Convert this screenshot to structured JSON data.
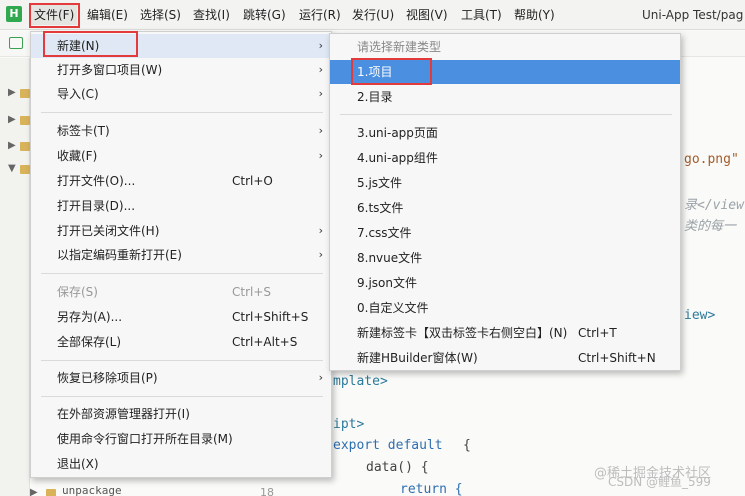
{
  "app": {
    "logo": "H",
    "title": "Uni-App Test/pag"
  },
  "menubar": {
    "items": [
      {
        "label": "文件(F)"
      },
      {
        "label": "编辑(E)"
      },
      {
        "label": "选择(S)"
      },
      {
        "label": "查找(I)"
      },
      {
        "label": "跳转(G)"
      },
      {
        "label": "运行(R)"
      },
      {
        "label": "发行(U)"
      },
      {
        "label": "视图(V)"
      },
      {
        "label": "工具(T)"
      },
      {
        "label": "帮助(Y)"
      }
    ]
  },
  "file_menu": {
    "items": [
      {
        "label": "新建(N)",
        "shortcut": "",
        "submenu": true
      },
      {
        "label": "打开多窗口项目(W)",
        "shortcut": "",
        "submenu": true
      },
      {
        "label": "导入(C)",
        "shortcut": "",
        "submenu": true
      },
      {
        "label": "标签卡(T)",
        "shortcut": "",
        "submenu": true
      },
      {
        "label": "收藏(F)",
        "shortcut": "",
        "submenu": true
      },
      {
        "label": "打开文件(O)...",
        "shortcut": "Ctrl+O"
      },
      {
        "label": "打开目录(D)...",
        "shortcut": ""
      },
      {
        "label": "打开已关闭文件(H)",
        "shortcut": "",
        "submenu": true
      },
      {
        "label": "以指定编码重新打开(E)",
        "shortcut": "",
        "submenu": true
      },
      {
        "label": "保存(S)",
        "shortcut": "Ctrl+S",
        "disabled": true
      },
      {
        "label": "另存为(A)...",
        "shortcut": "Ctrl+Shift+S"
      },
      {
        "label": "全部保存(L)",
        "shortcut": "Ctrl+Alt+S"
      },
      {
        "label": "恢复已移除项目(P)",
        "shortcut": "",
        "submenu": true
      },
      {
        "label": "在外部资源管理器打开(I)",
        "shortcut": ""
      },
      {
        "label": "使用命令行窗口打开所在目录(M)",
        "shortcut": ""
      },
      {
        "label": "退出(X)",
        "shortcut": ""
      }
    ]
  },
  "new_submenu": {
    "header": "请选择新建类型",
    "items": [
      {
        "label": "1.项目",
        "shortcut": ""
      },
      {
        "label": "2.目录",
        "shortcut": ""
      },
      {
        "label": "3.uni-app页面",
        "shortcut": ""
      },
      {
        "label": "4.uni-app组件",
        "shortcut": ""
      },
      {
        "label": "5.js文件",
        "shortcut": ""
      },
      {
        "label": "6.ts文件",
        "shortcut": ""
      },
      {
        "label": "7.css文件",
        "shortcut": ""
      },
      {
        "label": "8.nvue文件",
        "shortcut": ""
      },
      {
        "label": "9.json文件",
        "shortcut": ""
      },
      {
        "label": "0.自定义文件",
        "shortcut": ""
      },
      {
        "label": "新建标签卡【双击标签卡右侧空白】(N)",
        "shortcut": "Ctrl+T"
      },
      {
        "label": "新建HBuilder窗体(W)",
        "shortcut": "Ctrl+Shift+N"
      }
    ]
  },
  "editor": {
    "line1": "go.png\"",
    "line2": "录</view",
    "line3": "类的每一",
    "line4": "iew>",
    "line5": "mplate>",
    "line6": "ipt>",
    "line7_kw": "export default",
    "line7_brace": "{",
    "line8": "data() {",
    "line9": "return {",
    "line_no": "18",
    "folder_label": "unpackage"
  },
  "watermark": {
    "line1": "@稀土掘金技术社区",
    "line2": "CSDN @鲤鱼_599"
  },
  "colors": {
    "highlight": "#4a8fe0",
    "red_box": "#e33b3b",
    "logo": "#2fa84f"
  }
}
